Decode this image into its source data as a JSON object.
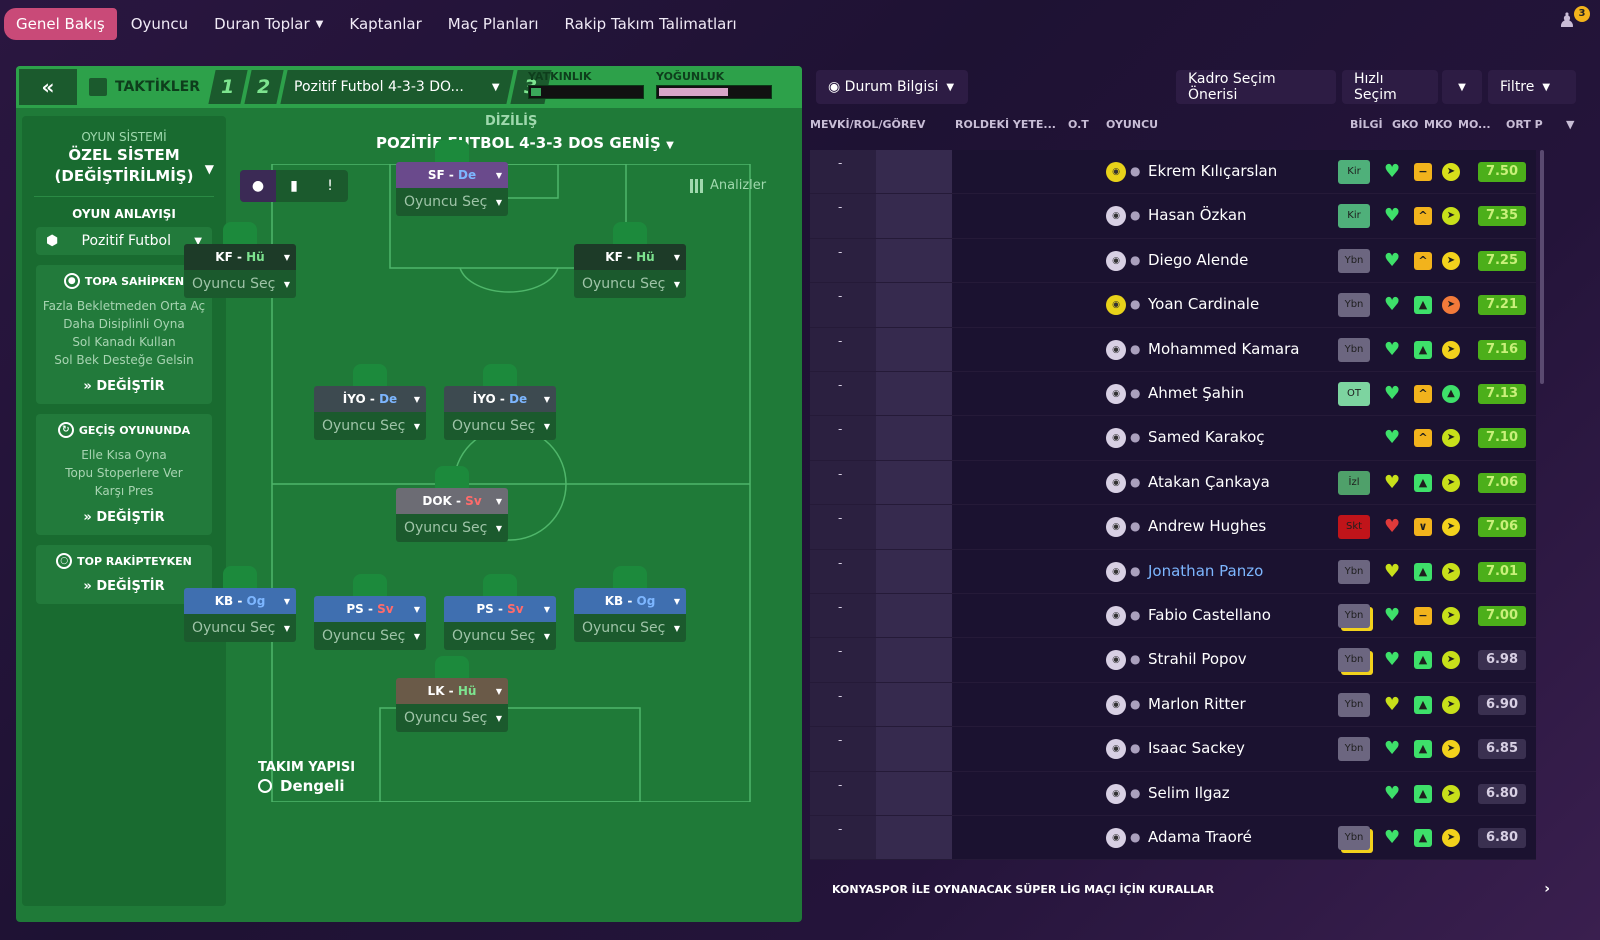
{
  "nav": {
    "items": [
      "Genel Bakış",
      "Oyuncu",
      "Duran Toplar",
      "Kaptanlar",
      "Maç Planları",
      "Rakip Takım Talimatları"
    ],
    "notifications": "3"
  },
  "tactics": {
    "title": "TAKTİKLER",
    "slot1": "1",
    "slot2": "2",
    "slot3": "3",
    "slot_name": "Pozitif Futbol 4-3-3 DO...",
    "meter1_label": "YATKINLIK",
    "meter1_value": 0.04,
    "meter2_label": "YOĞUNLUK",
    "meter2_value": 0.62,
    "system_label": "OYUN SİSTEMİ",
    "system_name_1": "ÖZEL SİSTEM",
    "system_name_2": "(DEĞİŞTİRİLMİŞ)",
    "mentality_label": "OYUN ANLAYIŞI",
    "mentality": "Pozitif Futbol",
    "in_possession": {
      "title": "TOPA SAHİPKEN",
      "items": [
        "Fazla Bekletmeden Orta Aç",
        "Daha Disiplinli Oyna",
        "Sol Kanadı Kullan",
        "Sol Bek Desteğe Gelsin"
      ],
      "change": "DEĞİŞTİR"
    },
    "transition": {
      "title": "GEÇİŞ OYUNUNDA",
      "items": [
        "Elle Kısa Oyna",
        "Topu Stoperlere Ver",
        "Karşı Pres"
      ],
      "change": "DEĞİŞTİR"
    },
    "out_possession": {
      "title": "TOP RAKİPTEYKEN",
      "change": "DEĞİŞTİR"
    },
    "formation_label": "DİZİLİŞ",
    "formation_name": "POZİTİF FUTBOL 4-3-3 DOS GENİŞ",
    "analyses": "Analizler",
    "select_player": "Oyuncu Seç",
    "team_shape_label": "TAKIM YAPISI",
    "team_shape": "Dengeli",
    "positions": [
      {
        "role": "SF",
        "duty": "De",
        "color": "#6a4a8c",
        "duty_class": "r-blue"
      },
      {
        "role": "KF",
        "duty": "Hü",
        "color": "#1d3b28",
        "duty_class": "r-green"
      },
      {
        "role": "KF",
        "duty": "Hü",
        "color": "#1d3b28",
        "duty_class": "r-green"
      },
      {
        "role": "İYO",
        "duty": "De",
        "color": "#3d4a50",
        "duty_class": "r-blue"
      },
      {
        "role": "İYO",
        "duty": "De",
        "color": "#3d4a50",
        "duty_class": "r-blue"
      },
      {
        "role": "DOK",
        "duty": "Sv",
        "color": "#6c6c74",
        "duty_class": "r-red"
      },
      {
        "role": "KB",
        "duty": "Og",
        "color": "#3f6fb0",
        "duty_class": "r-blue"
      },
      {
        "role": "PS",
        "duty": "Sv",
        "color": "#3f6fb0",
        "duty_class": "r-red"
      },
      {
        "role": "PS",
        "duty": "Sv",
        "color": "#3f6fb0",
        "duty_class": "r-red"
      },
      {
        "role": "KB",
        "duty": "Og",
        "color": "#3f6fb0",
        "duty_class": "r-blue"
      },
      {
        "role": "LK",
        "duty": "Hü",
        "color": "#6a5a48",
        "duty_class": "r-green"
      }
    ]
  },
  "players_panel": {
    "view": "Durum Bilgisi",
    "squad_suggestion": "Kadro Seçim Önerisi",
    "quick_pick": "Hızlı Seçim",
    "filter": "Filtre",
    "headers": [
      "MEVKİ/ROL/GÖREV",
      "ROLDEKİ YETE...",
      "O.T",
      "OYUNCU",
      "BİLGİ",
      "GKO",
      "MKO",
      "MO...",
      "ORT P"
    ],
    "rows": [
      {
        "dash": "-",
        "name": "Ekrem Kılıçarslan",
        "face": "yellow",
        "badge": "Kir",
        "badge_class": "b-kir",
        "heart": "#3ee06a",
        "mko": "−",
        "mko_color": "#f2b31c",
        "mo": "➤",
        "mo_color": "#d8e01a",
        "rating": "7.50",
        "hi": true
      },
      {
        "dash": "-",
        "name": "Hasan Özkan",
        "face": "white",
        "badge": "Kir",
        "badge_class": "b-kir",
        "heart": "#3ee06a",
        "mko": "^",
        "mko_color": "#f2b31c",
        "mo": "➤",
        "mo_color": "#c8e01a",
        "rating": "7.35",
        "hi": true
      },
      {
        "dash": "-",
        "name": "Diego Alende",
        "face": "white",
        "badge": "Ybn",
        "badge_class": "b-ybn",
        "heart": "#3ee06a",
        "mko": "^",
        "mko_color": "#f2b31c",
        "mo": "➤",
        "mo_color": "#f2d21c",
        "rating": "7.25",
        "hi": true
      },
      {
        "dash": "-",
        "name": "Yoan Cardinale",
        "face": "yellow",
        "badge": "Ybn",
        "badge_class": "b-ybn",
        "heart": "#3ee06a",
        "mko": "▲",
        "mko_color": "#3ee06a",
        "mo": "➤",
        "mo_color": "#f27a3a",
        "rating": "7.21",
        "hi": true
      },
      {
        "dash": "-",
        "name": "Mohammed Kamara",
        "face": "white",
        "badge": "Ybn",
        "badge_class": "b-ybn",
        "heart": "#3ee06a",
        "mko": "▲",
        "mko_color": "#3ee06a",
        "mo": "➤",
        "mo_color": "#f2d21c",
        "rating": "7.16",
        "hi": true
      },
      {
        "dash": "-",
        "name": "Ahmet Şahin",
        "face": "white",
        "badge": "OT",
        "badge_class": "b-ot",
        "heart": "#3ee06a",
        "mko": "^",
        "mko_color": "#f2b31c",
        "mo": "▲",
        "mo_color": "#3ee06a",
        "rating": "7.13",
        "hi": true
      },
      {
        "dash": "-",
        "name": "Samed Karakoç",
        "face": "white",
        "badge": "",
        "badge_class": "",
        "heart": "#3ee06a",
        "mko": "^",
        "mko_color": "#f2b31c",
        "mo": "➤",
        "mo_color": "#c8e01a",
        "rating": "7.10",
        "hi": true
      },
      {
        "dash": "-",
        "name": "Atakan Çankaya",
        "face": "white",
        "badge": "İzl",
        "badge_class": "b-izl",
        "heart": "#c8e01a",
        "mko": "▲",
        "mko_color": "#3ee06a",
        "mo": "➤",
        "mo_color": "#c8e01a",
        "rating": "7.06",
        "hi": true
      },
      {
        "dash": "-",
        "name": "Andrew Hughes",
        "face": "white",
        "badge": "Skt",
        "badge_class": "b-skt",
        "heart": "#e03a3a",
        "mko": "∨",
        "mko_color": "#f2b31c",
        "mo": "➤",
        "mo_color": "#f2d21c",
        "rating": "7.06",
        "hi": true
      },
      {
        "dash": "-",
        "name": "Jonathan Panzo",
        "face": "white",
        "badge": "Ybn",
        "badge_class": "b-ybn",
        "heart": "#c8e01a",
        "mko": "▲",
        "mko_color": "#3ee06a",
        "mo": "➤",
        "mo_color": "#c8e01a",
        "rating": "7.01",
        "hi": true,
        "link": true
      },
      {
        "dash": "-",
        "name": "Fabio Castellano",
        "face": "white",
        "badge": "Ybn",
        "badge_class": "b-ybn-y",
        "heart": "#3ee06a",
        "mko": "−",
        "mko_color": "#f2b31c",
        "mo": "➤",
        "mo_color": "#c8e01a",
        "rating": "7.00",
        "hi": true
      },
      {
        "dash": "-",
        "name": "Strahil Popov",
        "face": "white",
        "badge": "Ybn",
        "badge_class": "b-ybn-y",
        "heart": "#3ee06a",
        "mko": "▲",
        "mko_color": "#3ee06a",
        "mo": "➤",
        "mo_color": "#c8e01a",
        "rating": "6.98",
        "hi": false
      },
      {
        "dash": "-",
        "name": "Marlon Ritter",
        "face": "white",
        "badge": "Ybn",
        "badge_class": "b-ybn",
        "heart": "#c8e01a",
        "mko": "▲",
        "mko_color": "#3ee06a",
        "mo": "➤",
        "mo_color": "#c8e01a",
        "rating": "6.90",
        "hi": false
      },
      {
        "dash": "-",
        "name": "Isaac Sackey",
        "face": "white",
        "badge": "Ybn",
        "badge_class": "b-ybn",
        "heart": "#3ee06a",
        "mko": "▲",
        "mko_color": "#3ee06a",
        "mo": "➤",
        "mo_color": "#f2d21c",
        "rating": "6.85",
        "hi": false
      },
      {
        "dash": "-",
        "name": "Selim Ilgaz",
        "face": "white",
        "badge": "",
        "badge_class": "",
        "heart": "#3ee06a",
        "mko": "▲",
        "mko_color": "#3ee06a",
        "mo": "➤",
        "mo_color": "#c8e01a",
        "rating": "6.80",
        "hi": false
      },
      {
        "dash": "-",
        "name": "Adama Traoré",
        "face": "white",
        "badge": "Ybn",
        "badge_class": "b-ybn-y",
        "heart": "#3ee06a",
        "mko": "▲",
        "mko_color": "#3ee06a",
        "mo": "➤",
        "mo_color": "#f2d21c",
        "rating": "6.80",
        "hi": false
      }
    ],
    "rules_text": "KONYASPOR İLE OYNANACAK SÜPER LİG MAÇI İÇİN KURALLAR"
  }
}
